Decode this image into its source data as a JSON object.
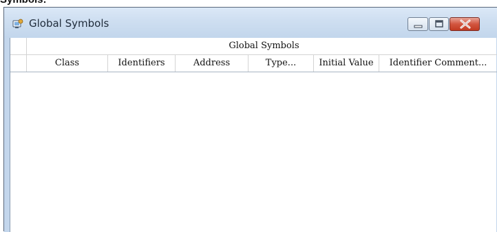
{
  "caption": "Symbols:",
  "window": {
    "title": "Global Symbols",
    "icon": "global-symbols-app-icon"
  },
  "titlebar_buttons": {
    "minimize_icon": "minimize-icon",
    "maximize_icon": "maximize-icon",
    "close_icon": "close-icon"
  },
  "table": {
    "group_header": "Global Symbols",
    "columns": [
      "Class",
      "Identifiers",
      "Address",
      "Type...",
      "Initial Value",
      "Identifier Comment..."
    ],
    "rows": []
  },
  "colors": {
    "frame": "#c3d6ec",
    "close_button": "#c84a35"
  }
}
